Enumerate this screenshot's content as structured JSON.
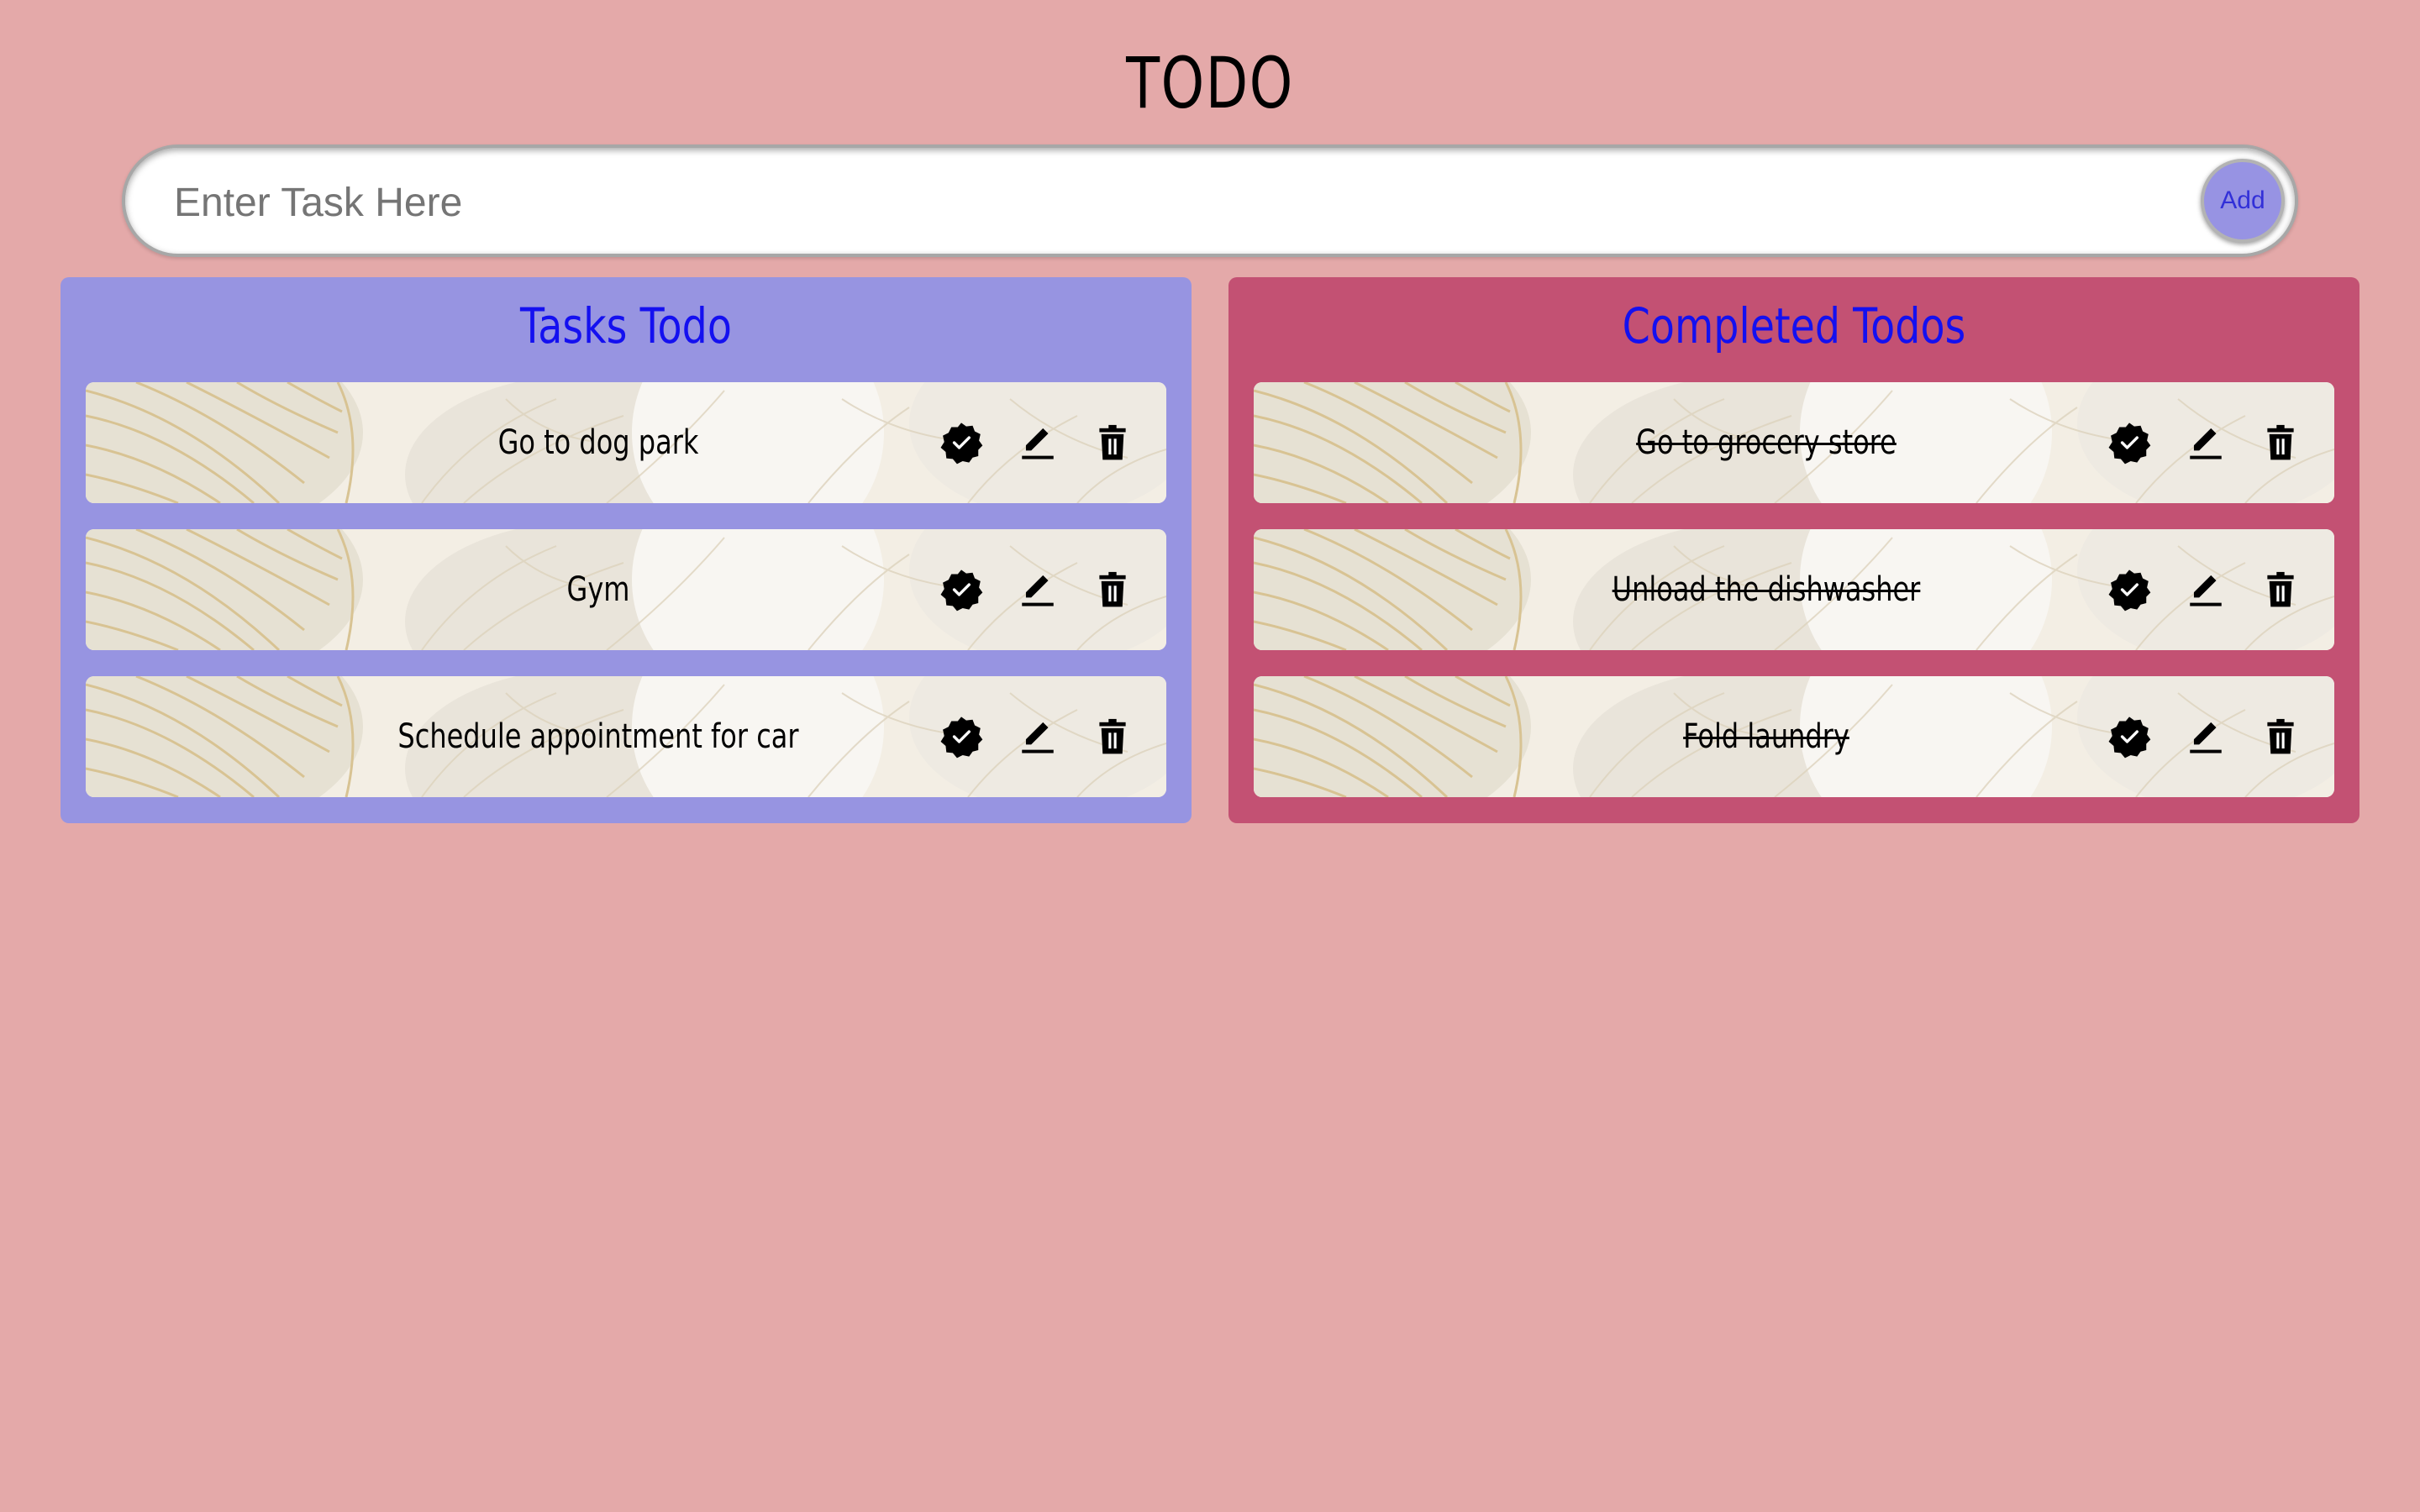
{
  "app": {
    "title": "TODO"
  },
  "input": {
    "placeholder": "Enter Task Here",
    "value": "",
    "add_label": "Add"
  },
  "todo_panel": {
    "title": "Tasks Todo",
    "color": "#9794e1",
    "items": [
      {
        "text": "Go to dog park"
      },
      {
        "text": "Gym"
      },
      {
        "text": "Schedule appointment for car"
      }
    ]
  },
  "completed_panel": {
    "title": "Completed Todos",
    "color": "#c35173",
    "items": [
      {
        "text": "Go to grocery store"
      },
      {
        "text": "Unload the dishwasher"
      },
      {
        "text": "Fold laundry"
      }
    ]
  },
  "item_actions": [
    "check-badge-icon",
    "edit-pencil-icon",
    "trash-icon"
  ],
  "colors": {
    "background": "#e4a9a9",
    "panel_title": "#1410f0",
    "add_button": "#9793e3"
  }
}
